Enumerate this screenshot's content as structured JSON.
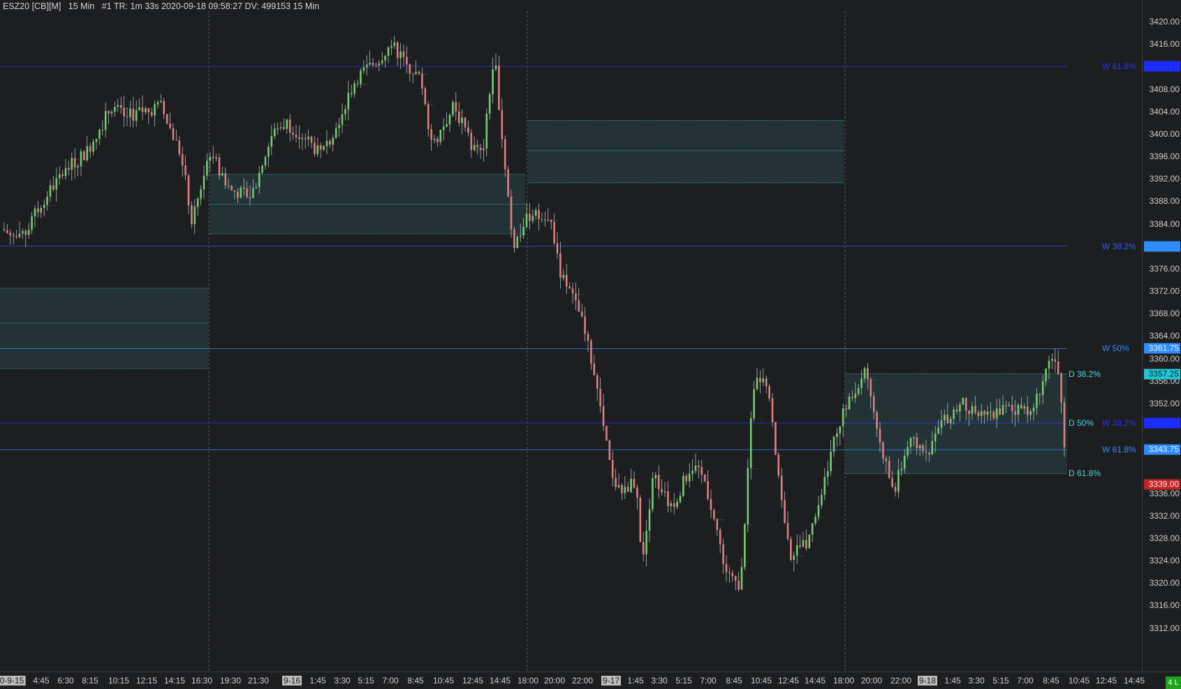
{
  "header": {
    "symbol": "ESZ20 [CB][M]",
    "timeframe": "15 Min",
    "info": "#1 TR: 1m 33s 2020-09-18 09:58:27 DV: 499153 15 Min"
  },
  "price_axis": {
    "ticks": [
      "3420.00",
      "3416.00",
      "3408.00",
      "3404.00",
      "3400.00",
      "3396.00",
      "3392.00",
      "3388.00",
      "3384.00",
      "3376.00",
      "3372.00",
      "3368.00",
      "3364.00",
      "3360.00",
      "3356.00",
      "3352.00",
      "3336.00",
      "3332.00",
      "3328.00",
      "3324.00",
      "3320.00",
      "3316.00",
      "3312.00"
    ]
  },
  "time_axis": {
    "labels": [
      {
        "text": "0-9-15",
        "date": true
      },
      {
        "text": "4:45"
      },
      {
        "text": "6:30"
      },
      {
        "text": "8:15"
      },
      {
        "text": "10:15"
      },
      {
        "text": "12:15"
      },
      {
        "text": "14:15"
      },
      {
        "text": "16:30"
      },
      {
        "text": "19:30"
      },
      {
        "text": "21:30"
      },
      {
        "text": "9-16",
        "date": true
      },
      {
        "text": "1:45"
      },
      {
        "text": "3:30"
      },
      {
        "text": "5:15"
      },
      {
        "text": "7:00"
      },
      {
        "text": "8:45"
      },
      {
        "text": "10:45"
      },
      {
        "text": "12:45"
      },
      {
        "text": "14:45"
      },
      {
        "text": "18:00"
      },
      {
        "text": "20:00"
      },
      {
        "text": "22:00"
      },
      {
        "text": "9-17",
        "date": true
      },
      {
        "text": "1:45"
      },
      {
        "text": "3:30"
      },
      {
        "text": "5:15"
      },
      {
        "text": "7:00"
      },
      {
        "text": "8:45"
      },
      {
        "text": "10:45"
      },
      {
        "text": "12:45"
      },
      {
        "text": "14:45"
      },
      {
        "text": "18:00"
      },
      {
        "text": "20:00"
      },
      {
        "text": "22:00"
      },
      {
        "text": "9-18",
        "date": true
      },
      {
        "text": "1:45"
      },
      {
        "text": "3:30"
      },
      {
        "text": "5:15"
      },
      {
        "text": "7:00"
      },
      {
        "text": "8:45"
      },
      {
        "text": "10:45"
      },
      {
        "text": "12:45"
      },
      {
        "text": "14:45"
      }
    ]
  },
  "levels": [
    {
      "label": "W 61.8%",
      "price": 3412.0,
      "color": "#2233ff",
      "badge": ""
    },
    {
      "label": "W 38.2%",
      "price": 3380.0,
      "color": "#2a5cff",
      "badge": ""
    },
    {
      "label": "W 50%",
      "price": 3361.75,
      "color": "#2f8cff",
      "badge": "3361.75"
    },
    {
      "label": "W 38.2%",
      "price": 3348.5,
      "color": "#2233ff",
      "badge": ""
    },
    {
      "label": "W 61.8%",
      "price": 3343.75,
      "color": "#2f8cff",
      "badge": "3343.75"
    }
  ],
  "day_levels": [
    {
      "label": "D 38.2%",
      "price": 3357.25,
      "badge": "3357.25"
    },
    {
      "label": "D 50%",
      "price": 3348.5,
      "badge": ""
    },
    {
      "label": "D 61.8%",
      "price": 3339.5,
      "badge": ""
    }
  ],
  "last_price": {
    "value": "3339.00",
    "color": "#c22222"
  },
  "live_badge": "4 L",
  "colors": {
    "background": "#1d1e20",
    "up": "#6fcf6f",
    "down": "#e07f7f",
    "zone": "#4dd6e0",
    "grid": "#5a5b5e"
  }
}
